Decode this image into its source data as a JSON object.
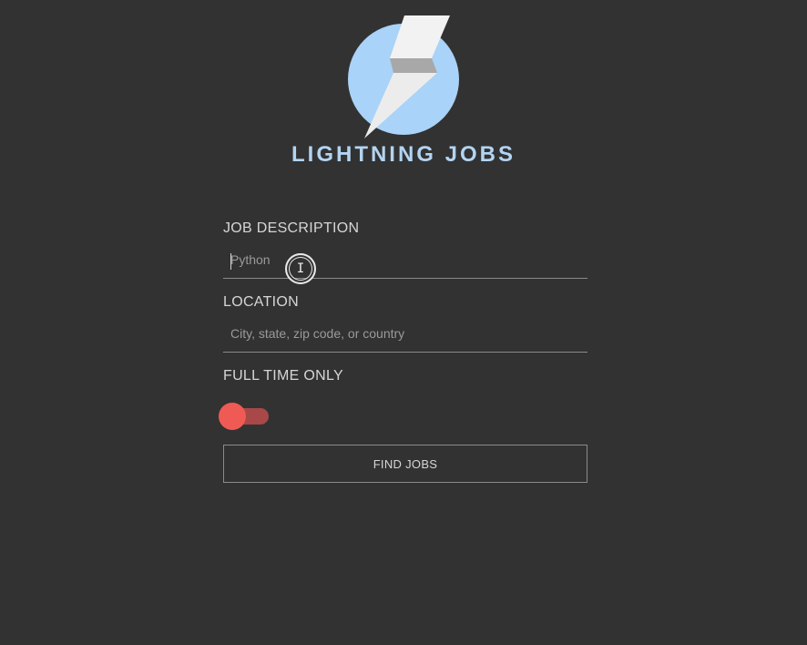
{
  "brand": {
    "name": "LIGHTNING JOBS",
    "colors": {
      "circle": "#a9d3f8",
      "bolt_light": "#f2f2f2",
      "bolt_dark": "#a8a8a8",
      "text": "#b3d4f2"
    }
  },
  "form": {
    "job_description": {
      "label": "JOB DESCRIPTION",
      "placeholder": "Python",
      "value": ""
    },
    "location": {
      "label": "LOCATION",
      "placeholder": "City, state, zip code, or country",
      "value": ""
    },
    "full_time": {
      "label": "FULL TIME ONLY",
      "checked": false,
      "accent": "#f05a54"
    },
    "submit_label": "FIND JOBS"
  },
  "cursor": {
    "icon": "text-cursor-icon",
    "glyph": "I"
  }
}
